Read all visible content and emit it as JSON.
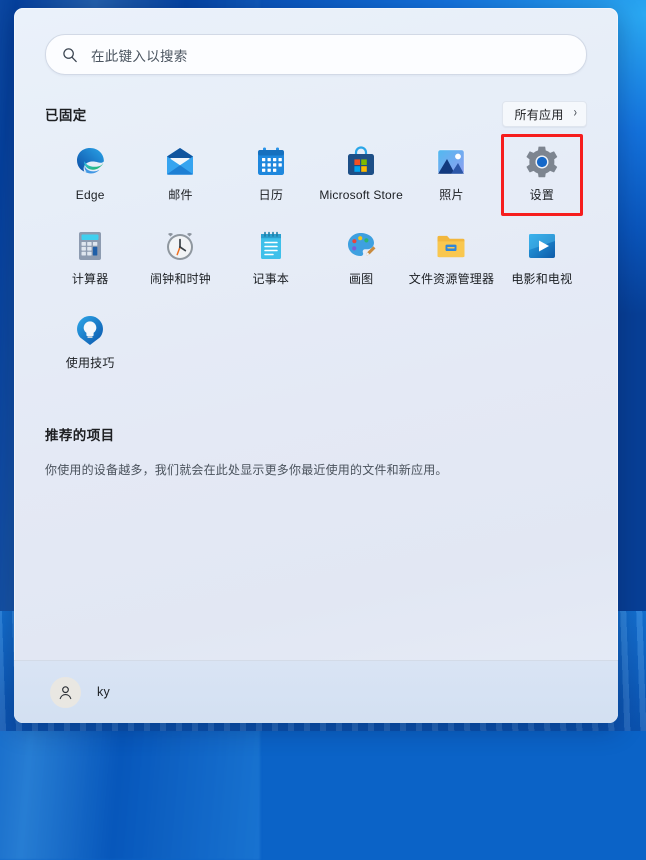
{
  "desktop": {
    "wallpaper_colors": [
      "#1a86e8",
      "#0c5fc4",
      "#063c92"
    ]
  },
  "start_menu": {
    "search": {
      "placeholder": "在此键入以搜索",
      "icon": "search-icon"
    },
    "pinned": {
      "title": "已固定",
      "all_apps_label": "所有应用",
      "all_apps_chevron": "›",
      "apps": [
        {
          "label": "Edge",
          "icon": "edge-icon",
          "highlighted": false
        },
        {
          "label": "邮件",
          "icon": "mail-icon",
          "highlighted": false
        },
        {
          "label": "日历",
          "icon": "calendar-icon",
          "highlighted": false
        },
        {
          "label": "Microsoft Store",
          "icon": "microsoft-store-icon",
          "highlighted": false
        },
        {
          "label": "照片",
          "icon": "photos-icon",
          "highlighted": false
        },
        {
          "label": "设置",
          "icon": "settings-gear-icon",
          "highlighted": true
        },
        {
          "label": "计算器",
          "icon": "calculator-icon",
          "highlighted": false
        },
        {
          "label": "闹钟和时钟",
          "icon": "alarm-clock-icon",
          "highlighted": false
        },
        {
          "label": "记事本",
          "icon": "notepad-icon",
          "highlighted": false
        },
        {
          "label": "画图",
          "icon": "paint-palette-icon",
          "highlighted": false
        },
        {
          "label": "文件资源管理器",
          "icon": "file-explorer-icon",
          "highlighted": false
        },
        {
          "label": "电影和电视",
          "icon": "movies-tv-icon",
          "highlighted": false
        },
        {
          "label": "使用技巧",
          "icon": "tips-lightbulb-icon",
          "highlighted": false
        }
      ]
    },
    "recommended": {
      "title": "推荐的项目",
      "description": "你使用的设备越多，我们就会在此处显示更多你最近使用的文件和新应用。"
    },
    "footer": {
      "user_name": "ky",
      "avatar_icon": "person-icon"
    }
  },
  "annotation": {
    "highlight_color": "#f61d1d",
    "highlight_target": "设置"
  }
}
